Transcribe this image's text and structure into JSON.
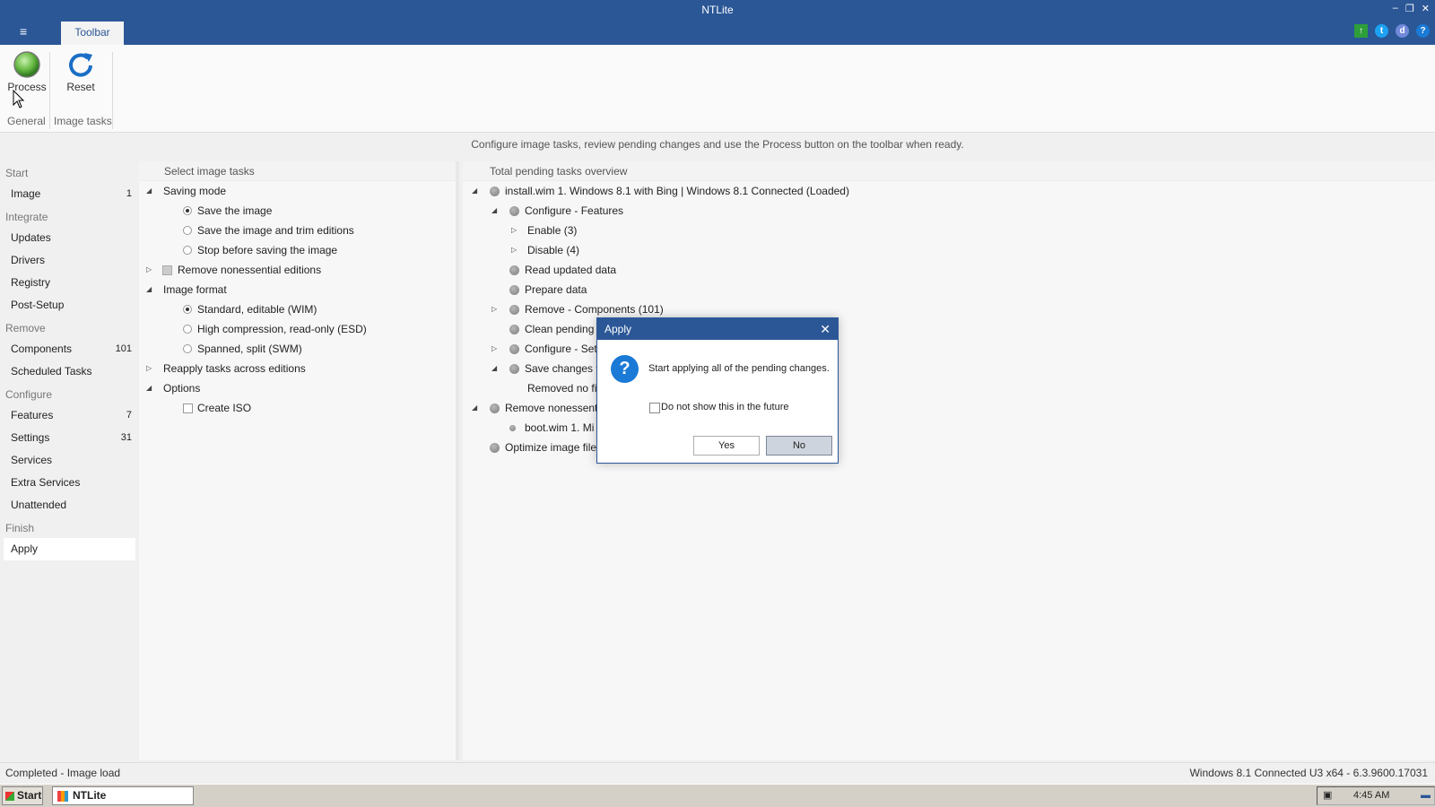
{
  "window": {
    "title": "NTLite",
    "tab_label": "Toolbar"
  },
  "ribbon": {
    "process_label": "Process",
    "reset_label": "Reset",
    "group_general": "General",
    "group_image_tasks": "Image tasks"
  },
  "info_text": "Configure image tasks, review pending changes and use the Process button on the toolbar when ready.",
  "sidebar": {
    "sections": [
      "Start",
      "Integrate",
      "Remove",
      "Configure",
      "Finish"
    ],
    "items": [
      {
        "label": "Image",
        "count": "1"
      },
      {
        "label": "Updates",
        "count": ""
      },
      {
        "label": "Drivers",
        "count": ""
      },
      {
        "label": "Registry",
        "count": ""
      },
      {
        "label": "Post-Setup",
        "count": ""
      },
      {
        "label": "Components",
        "count": "101"
      },
      {
        "label": "Scheduled Tasks",
        "count": ""
      },
      {
        "label": "Features",
        "count": "7"
      },
      {
        "label": "Settings",
        "count": "31"
      },
      {
        "label": "Services",
        "count": ""
      },
      {
        "label": "Extra Services",
        "count": ""
      },
      {
        "label": "Unattended",
        "count": ""
      },
      {
        "label": "Apply",
        "count": ""
      }
    ]
  },
  "image_tasks": {
    "header": "Select image tasks",
    "saving_mode": "Saving mode",
    "save_image": "Save the image",
    "save_trim": "Save the image and trim editions",
    "stop_before": "Stop before saving the image",
    "remove_nonessential": "Remove nonessential editions",
    "image_format": "Image format",
    "wim": "Standard, editable (WIM)",
    "esd": "High compression, read-only (ESD)",
    "swm": "Spanned, split (SWM)",
    "reapply": "Reapply tasks across editions",
    "options": "Options",
    "create_iso": "Create ISO"
  },
  "overview": {
    "header": "Total pending tasks overview",
    "rows": [
      "install.wim 1. Windows 8.1 with Bing  |  Windows 8.1 Connected  (Loaded)",
      "Configure - Features",
      "Enable (3)",
      "Disable (4)",
      "Read updated data",
      "Prepare data",
      "Remove - Components (101)",
      "Clean pending",
      "Configure - Set",
      "Save changes to",
      "Removed no fi",
      "Remove nonessenti",
      "boot.wim 1. Mi",
      "Optimize image file"
    ]
  },
  "dialog": {
    "title": "Apply",
    "message": "Start applying all of the pending changes.",
    "checkbox_label": "Do not show this in the future",
    "yes_label": "Yes",
    "no_label": "No"
  },
  "status": {
    "left": "Completed - Image load",
    "right": "Windows 8.1 Connected U3 x64 - 6.3.9600.17031"
  },
  "taskbar": {
    "start_label": "Start",
    "app_label": "NTLite",
    "clock": "4:45 AM"
  },
  "colors": {
    "accent": "#2b5797",
    "dialog_question": "#1a7ad6"
  }
}
